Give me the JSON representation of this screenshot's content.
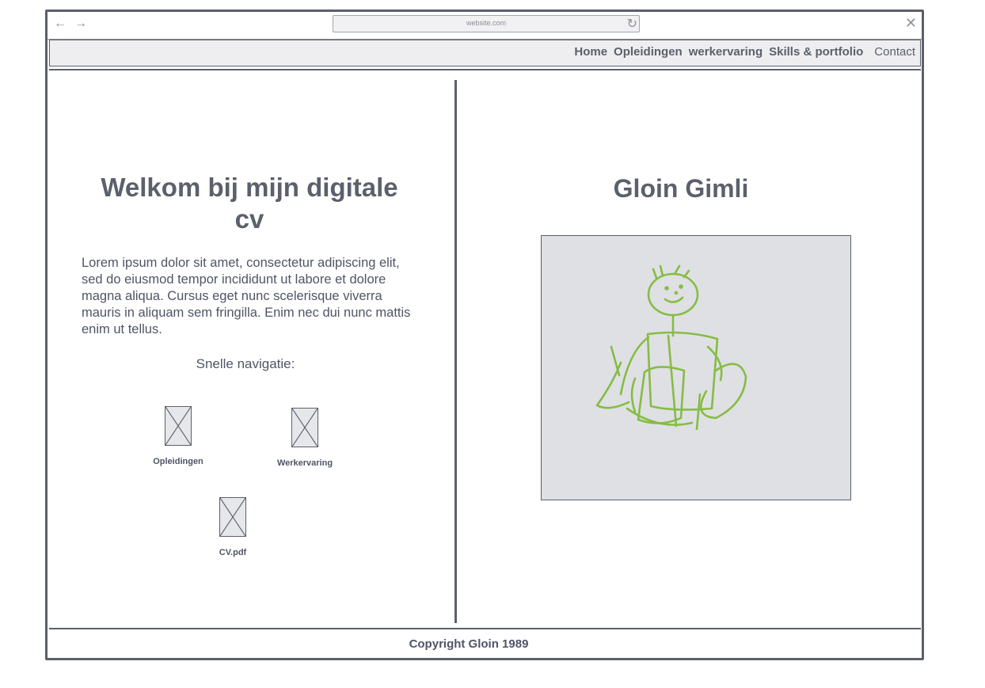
{
  "browser": {
    "url": "website.com",
    "back_icon": "arrow-left-icon",
    "forward_icon": "arrow-right-icon",
    "reload_icon": "reload-icon",
    "close_icon": "close-icon"
  },
  "nav": {
    "items": [
      "Home",
      "Opleidingen",
      "werkervaring",
      "Skills & portfolio",
      "Contact"
    ]
  },
  "left": {
    "title": "Welkom bij mijn digitale cv",
    "intro": "Lorem ipsum dolor sit amet, consectetur adipiscing elit, sed do eiusmod tempor incididunt ut labore et dolore magna aliqua. Cursus eget nunc scelerisque viverra mauris in aliquam sem fringilla. Enim nec dui nunc mattis enim ut tellus.",
    "quicknav_label": "Snelle navigatie:",
    "quicknav": [
      {
        "label": "Opleidingen"
      },
      {
        "label": "Werkervaring"
      },
      {
        "label": "CV.pdf"
      }
    ]
  },
  "right": {
    "name": "Gloin Gimli"
  },
  "footer": {
    "text": "Copyright Gloin 1989"
  },
  "colors": {
    "ink": "#5b606c",
    "photo_bg": "#dfe0e3",
    "sketch": "#86bc45"
  }
}
